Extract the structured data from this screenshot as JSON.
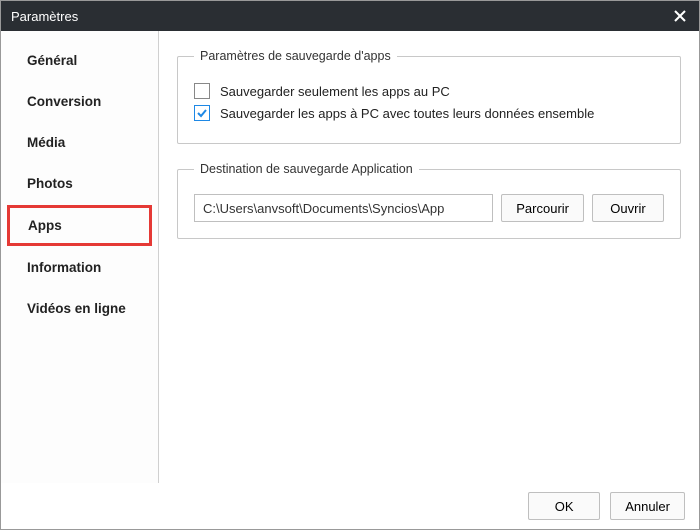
{
  "window": {
    "title": "Paramètres"
  },
  "sidebar": {
    "items": [
      {
        "label": "Général"
      },
      {
        "label": "Conversion"
      },
      {
        "label": "Média"
      },
      {
        "label": "Photos"
      },
      {
        "label": "Apps"
      },
      {
        "label": "Information"
      },
      {
        "label": "Vidéos en ligne"
      }
    ],
    "selected_index": 4
  },
  "panel_backup": {
    "legend": "Paramètres de sauvegarde d'apps",
    "opt_only_pc": "Sauvegarder seulement les apps au PC",
    "opt_with_data": "Sauvegarder les apps à PC avec toutes leurs données ensemble"
  },
  "panel_dest": {
    "legend": "Destination de sauvegarde Application",
    "path": "C:\\Users\\anvsoft\\Documents\\Syncios\\App",
    "browse": "Parcourir",
    "open": "Ouvrir"
  },
  "footer": {
    "ok": "OK",
    "cancel": "Annuler"
  }
}
